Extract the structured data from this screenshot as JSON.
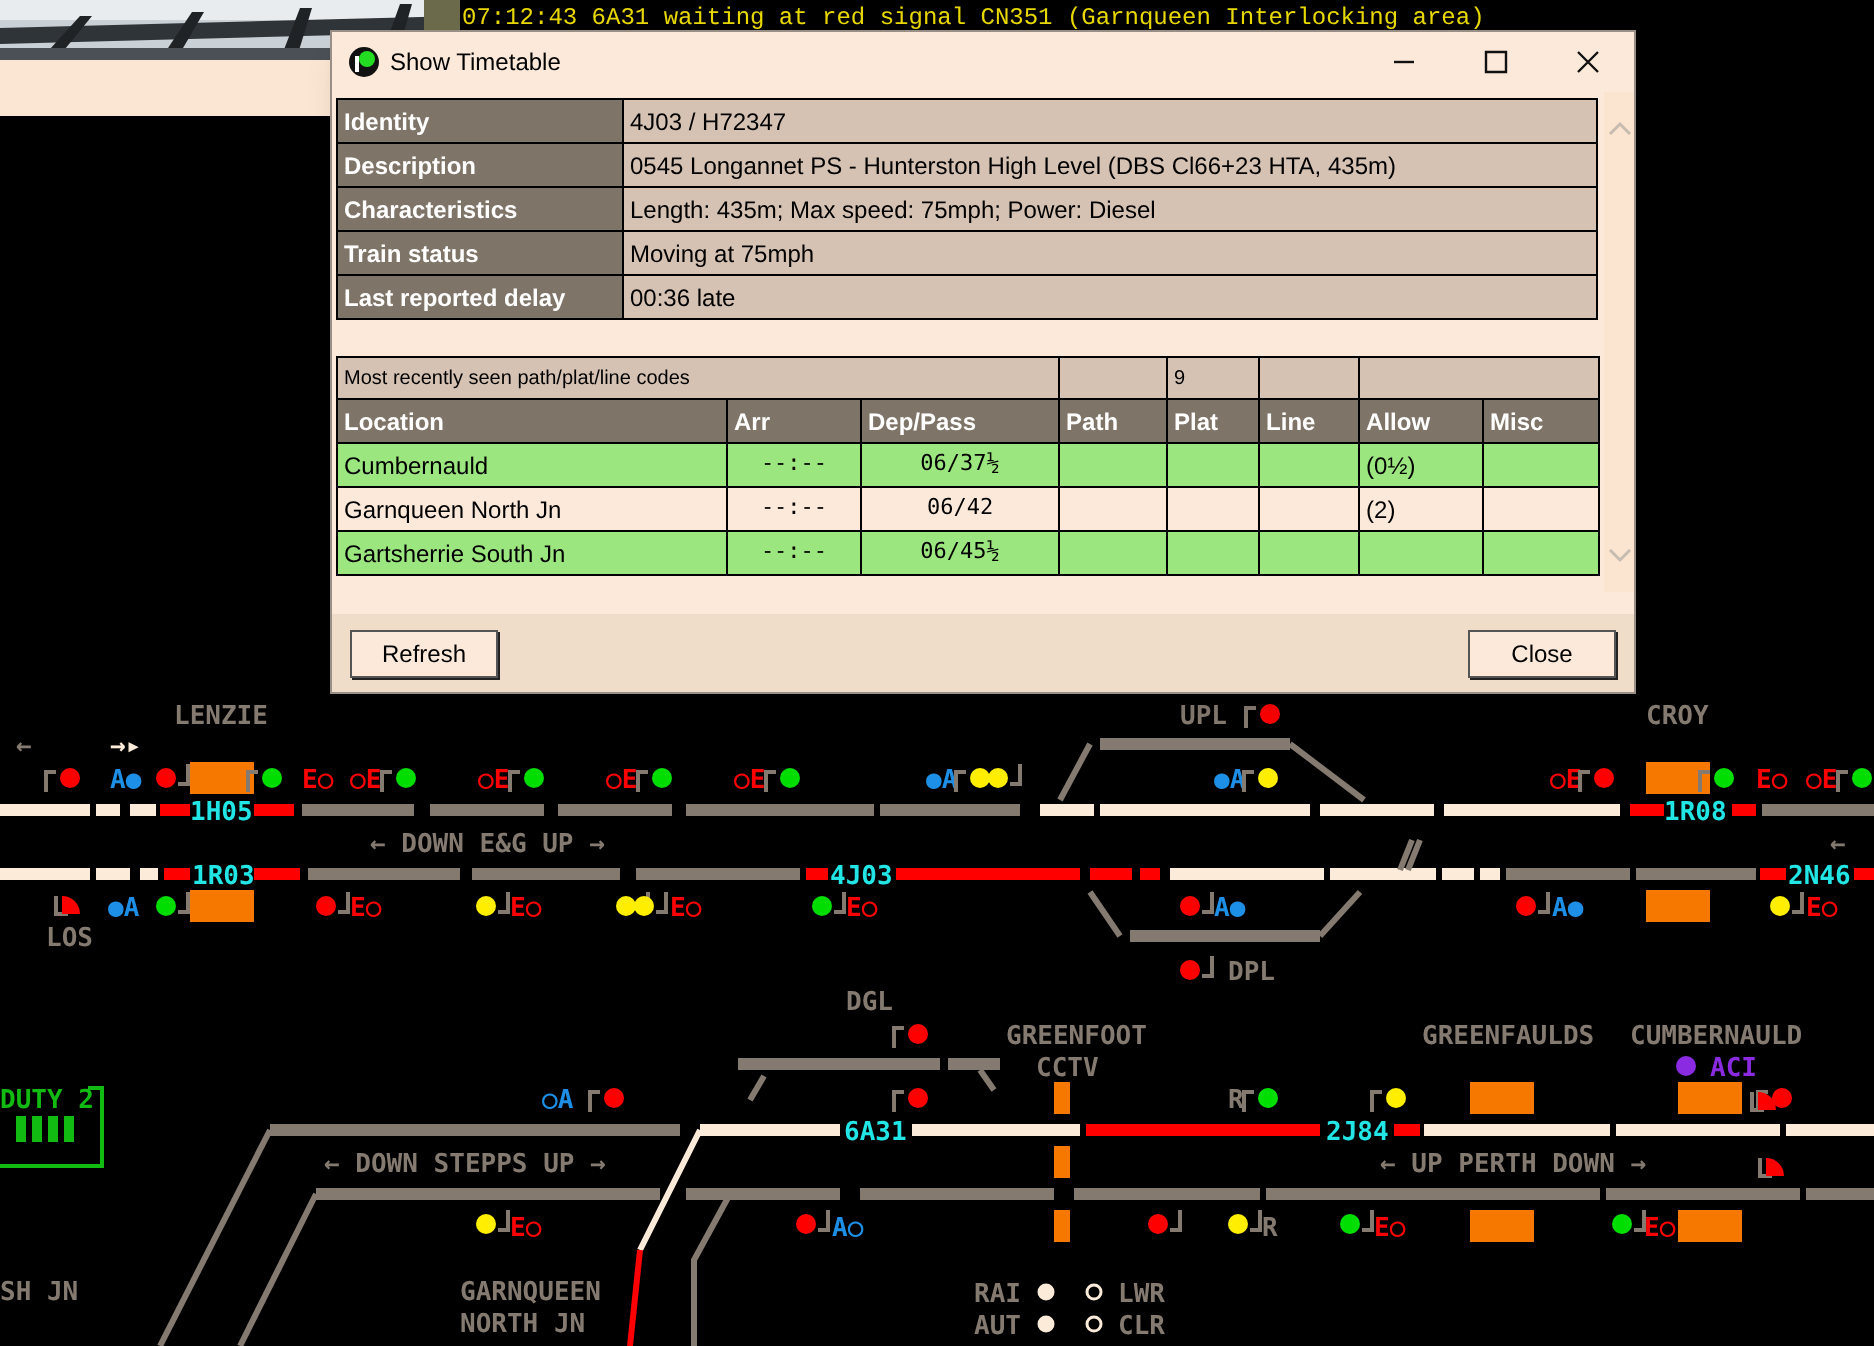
{
  "log": {
    "lines": [
      "07:12:43 6A31 waiting at red signal CN351 (Garnqueen Interlocking area)"
    ]
  },
  "dialog": {
    "title": "Show Timetable",
    "details": [
      {
        "label": "Identity",
        "value": "4J03 / H72347"
      },
      {
        "label": "Description",
        "value": "0545 Longannet PS - Hunterston High Level (DBS Cl66+23 HTA, 435m)"
      },
      {
        "label": "Characteristics",
        "value": "Length: 435m; Max speed: 75mph; Power: Diesel"
      },
      {
        "label": "Train status",
        "value": "Moving at 75mph"
      },
      {
        "label": "Last reported delay",
        "value": "00:36 late"
      }
    ],
    "codes": {
      "label": "Most recently seen path/plat/line codes",
      "plat": "9"
    },
    "columns": [
      "Location",
      "Arr",
      "Dep/Pass",
      "Path",
      "Plat",
      "Line",
      "Allow",
      "Misc"
    ],
    "rows": [
      {
        "location": "Cumbernauld",
        "arr": "--:--",
        "dep_pass": "06/37½",
        "allow": "(0½)",
        "highlighted": true
      },
      {
        "location": "Garnqueen North Jn",
        "arr": "--:--",
        "dep_pass": "06/42",
        "allow": "(2)",
        "highlighted": false
      },
      {
        "location": "Gartsherrie South Jn",
        "arr": "--:--",
        "dep_pass": "06/45½",
        "highlighted": true
      }
    ],
    "buttons": [
      "Refresh",
      "Close"
    ]
  },
  "diagram": {
    "labels": [
      "LENZIE",
      "← DOWN E&G UP →",
      "LOS",
      "UPL",
      "CROY",
      "DPL",
      "DGL",
      "GREENFOOT",
      "CCTV",
      "GREENFAULDS",
      "CUMBERNAULD",
      "← DOWN STEPPS UP →",
      "← UP PERTH DOWN →",
      "SH JN",
      "GARNQUEEN",
      "NORTH JN",
      "R",
      "R",
      "←",
      "→▸",
      "←"
    ],
    "trains": [
      "1H05",
      "1R03",
      "4J03",
      "6A31",
      "1R08",
      "2N46",
      "2J84"
    ],
    "markers": [
      "E○",
      "○E",
      "○E",
      "○E",
      "○E",
      "○E",
      "E○",
      "○E",
      "E○",
      "E○",
      "E○",
      "E○",
      "E○",
      "E○",
      "E○",
      "E○"
    ],
    "blue_markers": [
      "A●",
      "●A",
      "●A",
      "●A",
      "A●",
      "A●",
      "○A",
      "A○"
    ],
    "signals": [
      {
        "color": "#ff0000"
      },
      {
        "color": "#ff0000"
      },
      {
        "color": "#00dd00"
      },
      {
        "color": "#00dd00"
      },
      {
        "color": "#00dd00"
      },
      {
        "color": "#00dd00"
      },
      {
        "color": "#00dd00"
      },
      {
        "color": "#ffee00"
      },
      {
        "color": "#ffee00"
      },
      {
        "color": "#ffee00"
      },
      {
        "color": "#ff0000"
      },
      {
        "color": "#ff0000"
      },
      {
        "color": "#00dd00"
      },
      {
        "color": "#00dd00"
      },
      {
        "color": "#00dd00"
      },
      {
        "color": "#ff0000"
      },
      {
        "color": "#ffee00"
      },
      {
        "color": "#ffee00"
      },
      {
        "color": "#ffee00"
      },
      {
        "color": "#00dd00"
      },
      {
        "color": "#ff0000"
      },
      {
        "color": "#ff0000"
      },
      {
        "color": "#ffee00"
      },
      {
        "color": "#ff0000"
      },
      {
        "color": "#ff0000"
      },
      {
        "color": "#ff0000"
      },
      {
        "color": "#ff0000"
      },
      {
        "color": "#00dd00"
      },
      {
        "color": "#ffee00"
      },
      {
        "color": "#8a2be2"
      },
      {
        "color": "#ff0000"
      },
      {
        "color": "#ffee00"
      },
      {
        "color": "#ff0000"
      },
      {
        "color": "#ff0000"
      },
      {
        "color": "#ffee00"
      },
      {
        "color": "#00dd00"
      },
      {
        "color": "#00dd00"
      }
    ],
    "duty": "DUTY 2",
    "aci": "ACI",
    "indicators": [
      {
        "label": "RAI",
        "lit": true
      },
      {
        "label": "AUT",
        "lit": true
      },
      {
        "label": "LWR",
        "lit": false
      },
      {
        "label": "CLR",
        "lit": false
      }
    ]
  }
}
